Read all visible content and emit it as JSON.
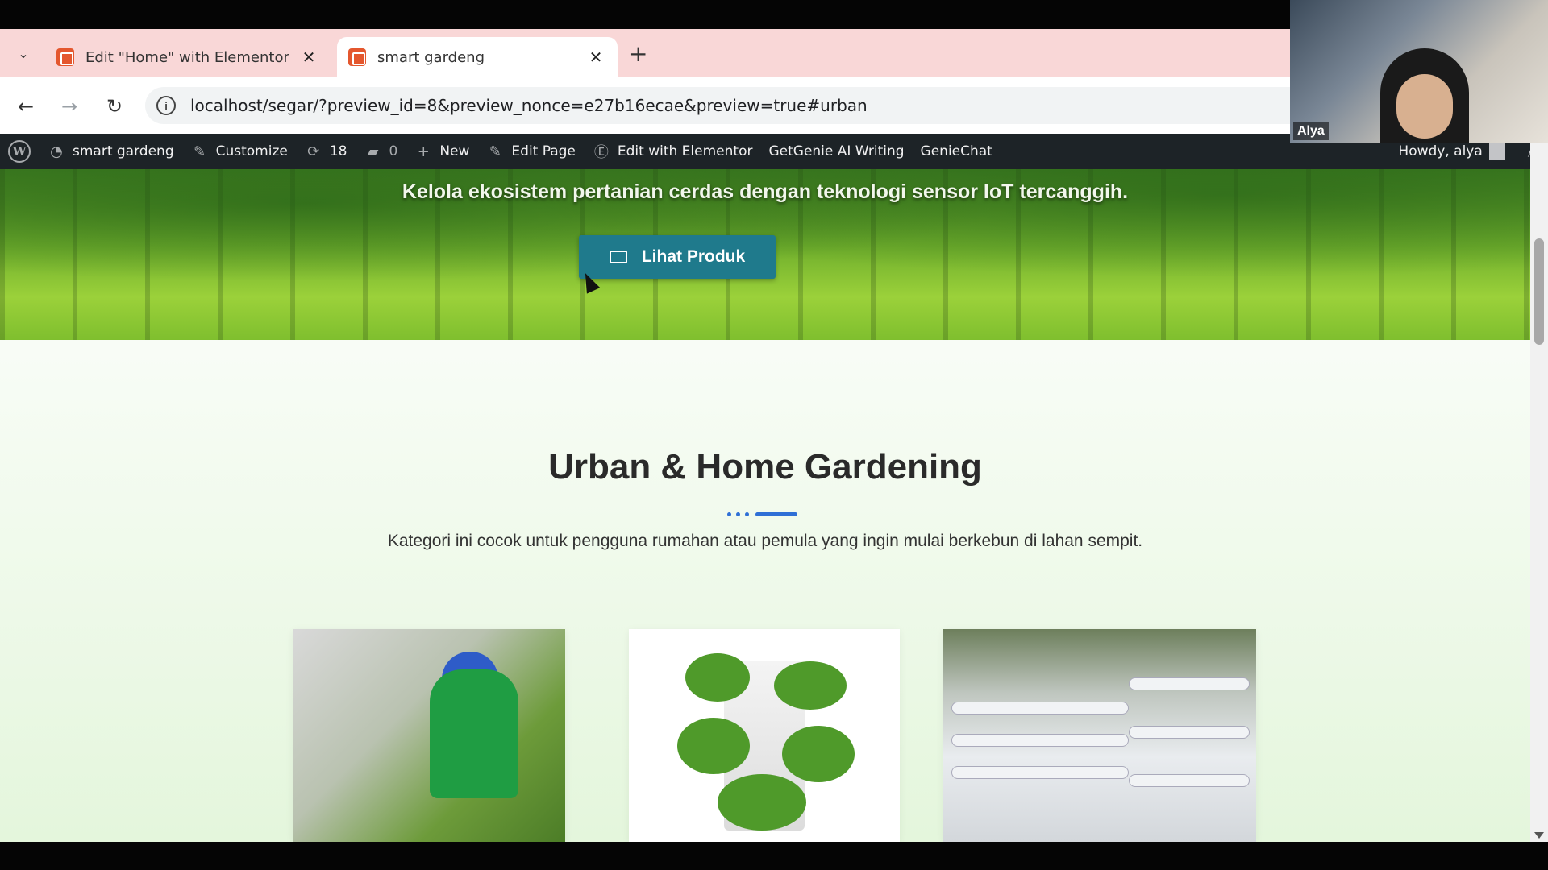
{
  "browser": {
    "tabs": [
      {
        "title": "Edit \"Home\" with Elementor",
        "active": false
      },
      {
        "title": "smart gardeng",
        "active": true
      }
    ],
    "url": "localhost/segar/?preview_id=8&preview_nonce=e27b16ecae&preview=true#urban"
  },
  "adminbar": {
    "site_name": "smart gardeng",
    "customize": "Customize",
    "updates_count": "18",
    "comments_count": "0",
    "new": "New",
    "edit_page": "Edit Page",
    "edit_elementor": "Edit with Elementor",
    "getgenie": "GetGenie AI Writing",
    "geniechat": "GenieChat",
    "howdy": "Howdy, alya"
  },
  "hero": {
    "subtitle": "Kelola ekosistem pertanian cerdas dengan teknologi sensor IoT tercanggih.",
    "button_label": "Lihat Produk"
  },
  "section": {
    "title": "Urban & Home Gardening",
    "description": "Kategori ini cocok untuk pengguna rumahan atau pemula yang ingin mulai berkebun di lahan sempit."
  },
  "webcam": {
    "name": "Alya"
  },
  "colors": {
    "adminbar_bg": "#1d2327",
    "tabbar_bg": "#f9d7d7",
    "button_bg": "#1f7a8c",
    "divider_accent": "#2f6fd6"
  }
}
